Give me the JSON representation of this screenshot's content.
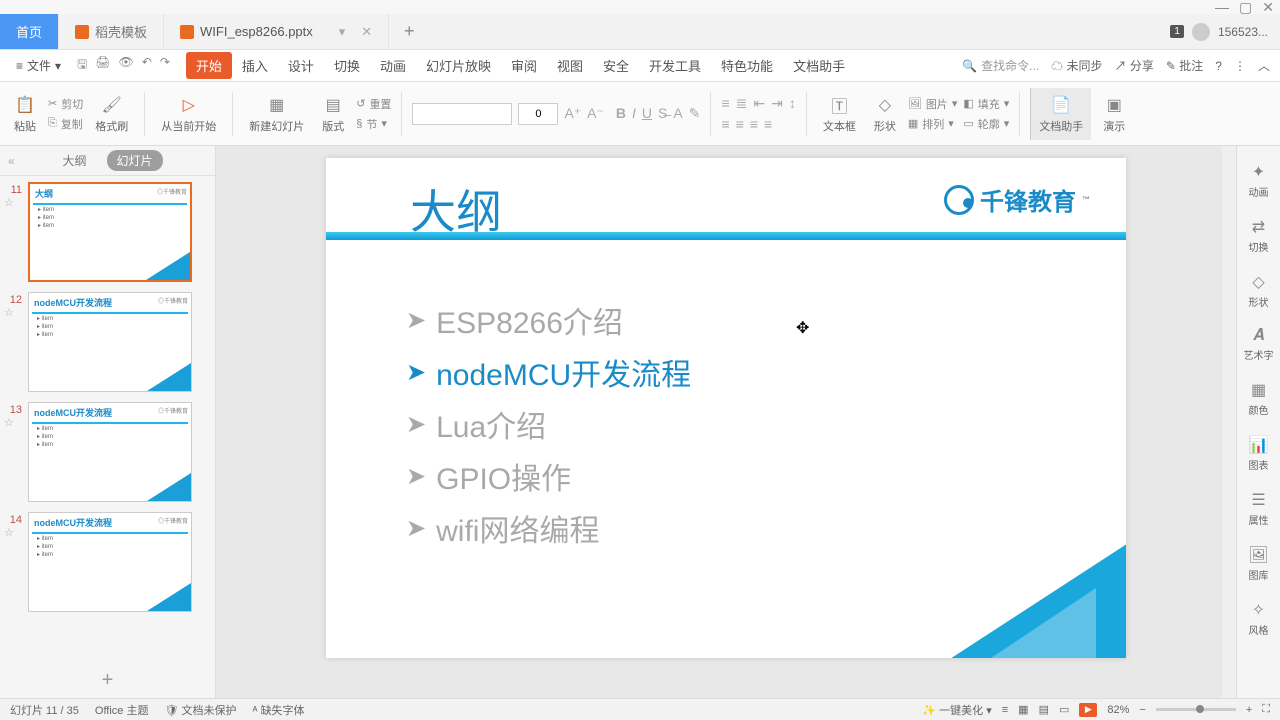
{
  "titlebar": {
    "min": "—",
    "max": "▢",
    "close": "✕"
  },
  "tabs": {
    "home": "首页",
    "doke": "稻壳模板",
    "file_icon_badge": "P",
    "file": "WIFI_esp8266.pptx"
  },
  "user": {
    "badge": "1",
    "name": "156523..."
  },
  "file_menu": "文件",
  "menus": [
    "开始",
    "插入",
    "设计",
    "切换",
    "动画",
    "幻灯片放映",
    "审阅",
    "视图",
    "安全",
    "开发工具",
    "特色功能",
    "文档助手"
  ],
  "search_placeholder": "查找命令...",
  "menu_right": {
    "sync": "未同步",
    "share": "分享",
    "annotate": "批注"
  },
  "ribbon": {
    "paste": "粘贴",
    "cut": "剪切",
    "copy": "复制",
    "format_painter": "格式刷",
    "from_current": "从当前开始",
    "new_slide": "新建幻灯片",
    "layout": "版式",
    "reset": "重置",
    "section": "节",
    "font_size": "0",
    "textbox": "文本框",
    "shape": "形状",
    "picture": "图片",
    "fill": "填充",
    "arrange": "排列",
    "outline": "轮廓",
    "doc_assist": "文档助手",
    "present": "演示"
  },
  "thumb_tabs": {
    "outline": "大纲",
    "slides": "幻灯片"
  },
  "thumbs": [
    {
      "num": "11",
      "title": "大纲"
    },
    {
      "num": "12",
      "title": "nodeMCU开发流程"
    },
    {
      "num": "13",
      "title": "nodeMCU开发流程"
    },
    {
      "num": "14",
      "title": "nodeMCU开发流程"
    }
  ],
  "slide": {
    "title": "大纲",
    "brand": "千锋教育",
    "items": [
      "ESP8266介绍",
      "nodeMCU开发流程",
      "Lua介绍",
      "GPIO操作",
      "wifi网络编程"
    ],
    "active_index": 1
  },
  "right_panel": [
    "动画",
    "切换",
    "形状",
    "艺术字",
    "颜色",
    "图表",
    "属性",
    "图库",
    "风格"
  ],
  "status": {
    "counter": "幻灯片 11 / 35",
    "theme": "Office 主题",
    "protect": "文档未保护",
    "font_missing": "缺失字体",
    "beautify": "一键美化",
    "zoom": "82%"
  }
}
